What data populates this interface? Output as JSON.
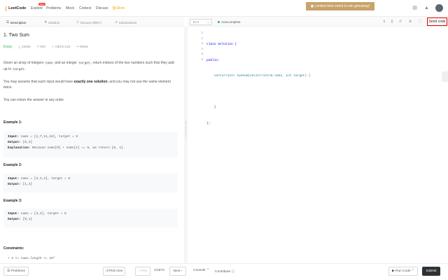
{
  "nav": {
    "logo": "LeetCode",
    "links": [
      "Explore",
      "Problems",
      "Mock",
      "Contest",
      "Discuss",
      "Store"
    ],
    "new_badge": "New",
    "promo": "Limited time event to win giveaway!"
  },
  "tabs": [
    "Description",
    "Solution",
    "Discuss (999+)",
    "Submissions"
  ],
  "problem": {
    "title": "1. Two Sum",
    "difficulty": "Easy",
    "likes": "19156",
    "dislikes": "633",
    "add_to_list": "Add to List",
    "share": "Share",
    "desc1_a": "Given an array of integers ",
    "desc1_nums": "nums",
    "desc1_b": " and an integer ",
    "desc1_target": "target",
    "desc1_c": ", return indices of the two numbers such that they add up to ",
    "desc1_target2": "target",
    "desc1_d": ".",
    "desc2_a": "You may assume that each input would have ",
    "desc2_b": "exactly one solution",
    "desc2_c": ", and you may not use the same element twice.",
    "desc3": "You can return the answer in any order.",
    "examples": [
      {
        "title": "Example 1:",
        "input": "nums = [2,7,11,15], target = 9",
        "output": "[0,1]",
        "explanation": "Because nums[0] + nums[1] == 9, we return [0, 1]."
      },
      {
        "title": "Example 2:",
        "input": "nums = [3,2,4], target = 6",
        "output": "[1,2]"
      },
      {
        "title": "Example 3:",
        "input": "nums = [3,3], target = 6",
        "output": "[0,1]"
      }
    ],
    "labels": {
      "input": "Input:",
      "output": "Output:",
      "explanation": "Explanation:"
    },
    "constraints_title": "Constraints:",
    "constraint1": "2 <= nums.length <= 10⁴"
  },
  "editor": {
    "language": "C++",
    "autocomplete": "Autocomplete",
    "send_code": "Send code",
    "line_numbers": [
      "1",
      "2",
      "3",
      "4",
      "5",
      "6"
    ],
    "code_lines": [
      "class Solution {",
      "public:",
      "    vector<int> twoSum(vector<int>& nums, int target) {",
      "        ",
      "    }",
      "};"
    ]
  },
  "bottom": {
    "problems": "Problems",
    "pick_one": "Pick One",
    "prev": "Prev",
    "page": "1/1973",
    "next": "Next",
    "console": "Console",
    "contribute": "Contribute",
    "run_code": "Run Code",
    "submit": "Submit"
  }
}
